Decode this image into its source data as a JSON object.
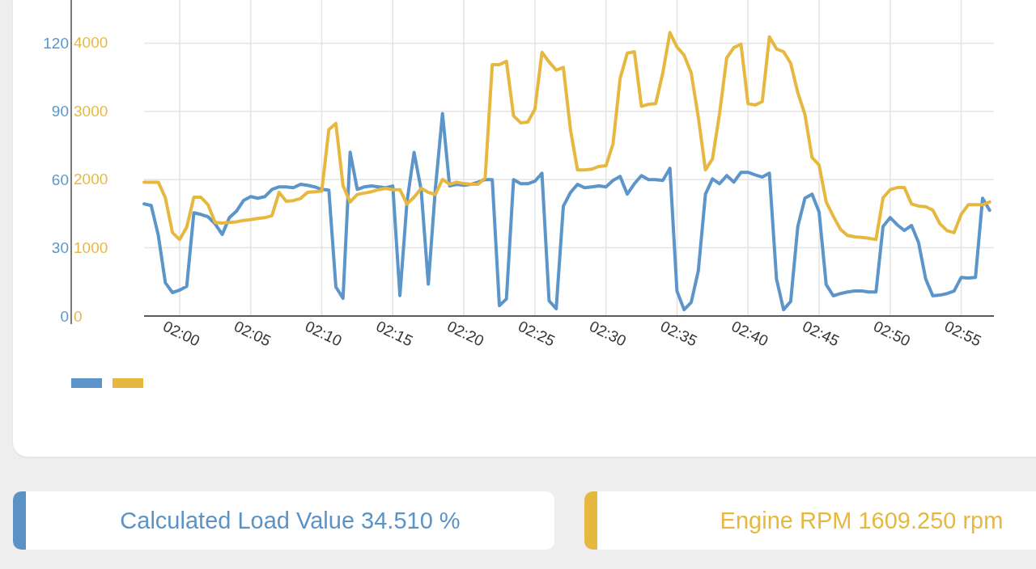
{
  "chart": {
    "chart_data": {
      "type": "line",
      "grid": true,
      "categories": [
        null,
        null,
        null,
        null,
        null,
        "02:00",
        null,
        null,
        null,
        null,
        null,
        null,
        null,
        null,
        null,
        "02:05",
        null,
        null,
        null,
        null,
        null,
        null,
        null,
        null,
        null,
        "02:10",
        null,
        null,
        null,
        null,
        null,
        null,
        null,
        null,
        null,
        "02:15",
        null,
        null,
        null,
        null,
        null,
        null,
        null,
        null,
        null,
        "02:20",
        null,
        null,
        null,
        null,
        null,
        null,
        null,
        null,
        null,
        "02:25",
        null,
        null,
        null,
        null,
        null,
        null,
        null,
        null,
        null,
        "02:30",
        null,
        null,
        null,
        null,
        null,
        null,
        null,
        null,
        null,
        "02:35",
        null,
        null,
        null,
        null,
        null,
        null,
        null,
        null,
        null,
        "02:40",
        null,
        null,
        null,
        null,
        null,
        null,
        null,
        null,
        null,
        "02:45",
        null,
        null,
        null,
        null,
        null,
        null,
        null,
        null,
        null,
        "02:50",
        null,
        null,
        null,
        null,
        null,
        null,
        null,
        null,
        null,
        "02:55",
        null,
        null,
        null,
        null
      ],
      "ylim": [
        0,
        139
      ],
      "yticks": [
        0,
        30,
        60,
        90,
        120
      ],
      "y2lim": [
        0,
        4627
      ],
      "y2ticks": [
        0,
        1000,
        2000,
        3000,
        4000
      ],
      "series": [
        {
          "color": "#5b95c9",
          "values": [
            49.3,
            48.6,
            35.5,
            14.6,
            10.3,
            11.4,
            13.1,
            45.4,
            44.7,
            43.7,
            40.5,
            35.9,
            43.3,
            46.1,
            50.8,
            52.5,
            51.8,
            52.5,
            55.7,
            56.8,
            56.8,
            56.4,
            57.9,
            57.5,
            56.8,
            55.7,
            55.4,
            12.8,
            7.8,
            72.1,
            55.7,
            56.8,
            57.2,
            56.8,
            56.4,
            57.2,
            9.0,
            50,
            72,
            55.4,
            14,
            56,
            89.1,
            57.2,
            57.9,
            57.5,
            57.9,
            58.9,
            60.0,
            60.0,
            4.6,
            7.5,
            60.0,
            58.2,
            58.2,
            59.3,
            62.8,
            6.7,
            3.2,
            48.3,
            54.3,
            57.9,
            56.4,
            56.8,
            57.2,
            56.8,
            59.6,
            61.4,
            53.6,
            58.2,
            61.8,
            60.0,
            60.0,
            59.6,
            65.0,
            11.0,
            2.8,
            6.0,
            19.9,
            53.6,
            60.3,
            58.2,
            61.8,
            58.9,
            63.2,
            63.2,
            62.1,
            61.1,
            62.8,
            16.3,
            2.8,
            6.4,
            39.4,
            51.8,
            53.6,
            45.8,
            13.8,
            8.9,
            9.9,
            10.6,
            11.0,
            11.0,
            10.6,
            10.6,
            39.4,
            43.3,
            40.1,
            37.6,
            39.8,
            32.3,
            16.3,
            8.9,
            9.2,
            9.9,
            11.0,
            17.0,
            16.7,
            17.0,
            51.8,
            46.5
          ]
        },
        {
          "color": "#e6b840",
          "axis": "y2",
          "values": [
            1960,
            1960,
            1960,
            1730,
            1220,
            1120,
            1300,
            1740,
            1740,
            1630,
            1370,
            1360,
            1370,
            1380,
            1400,
            1410,
            1430,
            1440,
            1470,
            1810,
            1680,
            1690,
            1720,
            1810,
            1820,
            1830,
            2730,
            2820,
            1910,
            1670,
            1780,
            1800,
            1820,
            1850,
            1870,
            1850,
            1850,
            1640,
            1740,
            1870,
            1810,
            1780,
            2000,
            1930,
            1960,
            1940,
            1930,
            1930,
            2020,
            3680,
            3680,
            3730,
            2930,
            2830,
            2840,
            3030,
            3860,
            3720,
            3600,
            3640,
            2730,
            2140,
            2140,
            2150,
            2190,
            2200,
            2520,
            3480,
            3850,
            3870,
            3070,
            3100,
            3110,
            3560,
            4150,
            3940,
            3820,
            3560,
            2910,
            2140,
            2300,
            2970,
            3780,
            3930,
            3980,
            3110,
            3090,
            3140,
            4090,
            3910,
            3870,
            3700,
            3270,
            2950,
            2320,
            2210,
            1670,
            1460,
            1270,
            1180,
            1160,
            1150,
            1140,
            1120,
            1730,
            1850,
            1880,
            1880,
            1640,
            1610,
            1600,
            1550,
            1350,
            1250,
            1220,
            1490,
            1630,
            1630,
            1630,
            1670
          ]
        }
      ]
    }
  },
  "readouts": [
    {
      "label": "Calculated Load Value 34.510 %",
      "color": "#5b93c7"
    },
    {
      "label": "Engine RPM 1609.250 rpm",
      "color": "#e6b840"
    }
  ]
}
